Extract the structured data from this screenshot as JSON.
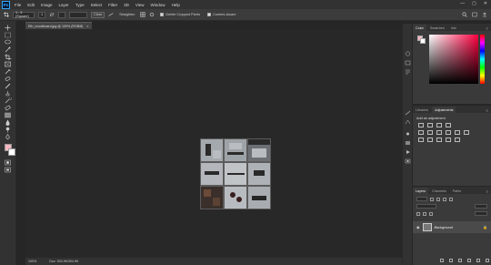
{
  "app": {
    "logo_text": "Ps",
    "menu": [
      "File",
      "Edit",
      "Image",
      "Layer",
      "Type",
      "Select",
      "Filter",
      "3D",
      "View",
      "Window",
      "Help"
    ],
    "window_controls": [
      "—",
      "▢",
      "✕"
    ]
  },
  "options_bar": {
    "ratio_select": "1 : 3 (Square)",
    "ratio_value": "1",
    "clear_label": "Clear",
    "straighten_label": "Straighten",
    "delete_cropped_label": "Delete Cropped Pixels",
    "content_aware_label": "Content-Aware"
  },
  "document": {
    "tab_title": "Eth_moodboard.jpg @ 100% (RGB/8)",
    "tab_close": "×"
  },
  "status_bar": {
    "zoom": "100%",
    "doc_info": "Doc: 304.9K/304.9K"
  },
  "panels": {
    "color_tabs": [
      "Color",
      "Swatches",
      "Info"
    ],
    "adjust_tabs": [
      "Libraries",
      "Adjustments"
    ],
    "adjust_header": "Add an adjustment",
    "layers_tabs": [
      "Layers",
      "Channels",
      "Paths"
    ],
    "layer_name": "Background"
  },
  "colors": {
    "foreground": "#f4b6bf",
    "background": "#ffffff",
    "accent": "#31a8ff"
  }
}
